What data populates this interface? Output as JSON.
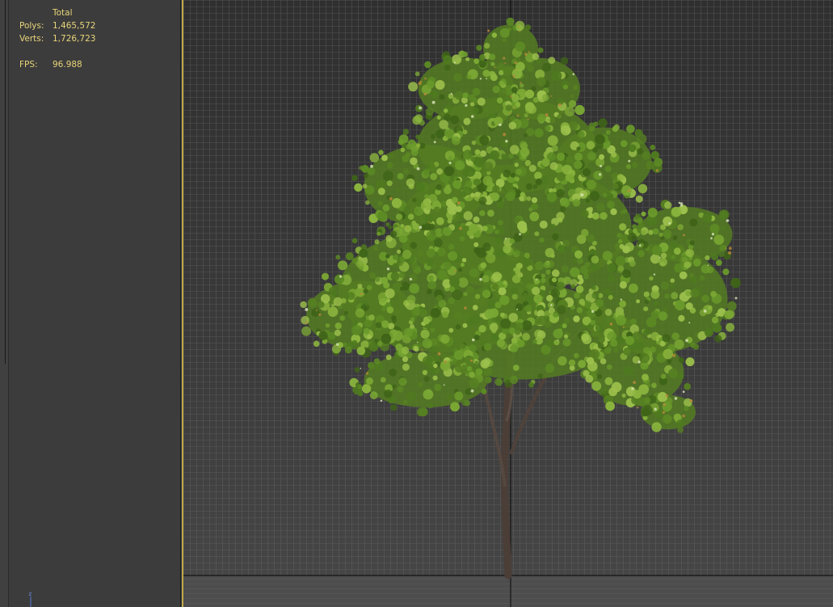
{
  "stats": {
    "header": "Total",
    "polys_label": "Polys:",
    "polys_value": "1,465,572",
    "verts_label": "Verts:",
    "verts_value": "1,726,723",
    "fps_label": "FPS:",
    "fps_value": "96.988"
  },
  "axis": {
    "z_label": "z"
  },
  "colors": {
    "stats_text": "#e8d57a",
    "active_border": "#bfa84a",
    "grid_line": "#6e6e6e",
    "foliage": "#6f9a2c",
    "trunk": "#4a3c34"
  }
}
